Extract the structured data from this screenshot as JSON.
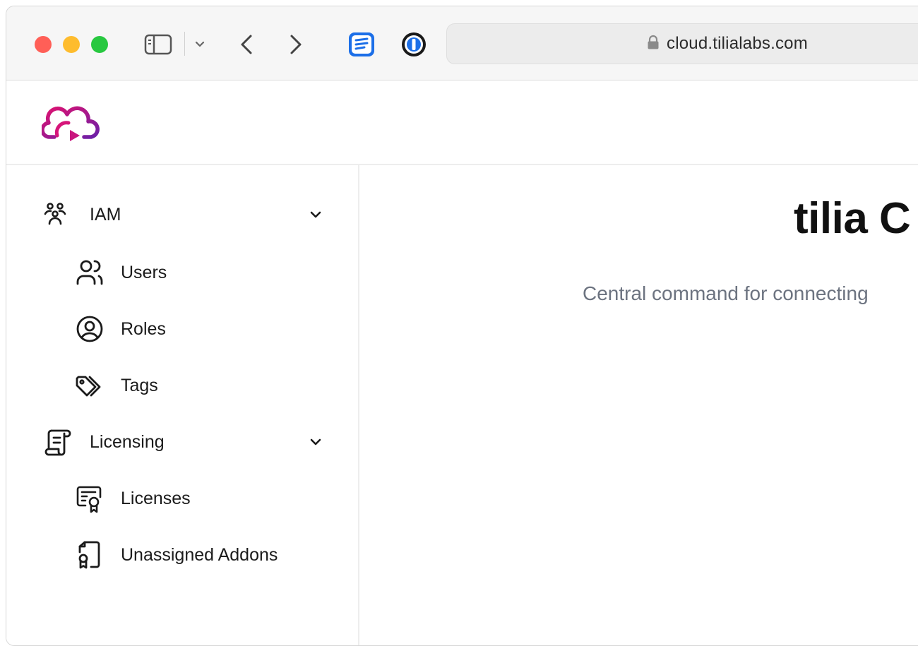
{
  "browser": {
    "url": "cloud.tilialabs.com",
    "traffic_lights": [
      "#ff5f57",
      "#febc2e",
      "#28c840"
    ]
  },
  "brand": {
    "logo_icon": "tilia-cloud-logo-icon",
    "colors": {
      "magenta": "#d6157a",
      "purple": "#6b1fa8"
    }
  },
  "sidebar": {
    "groups": [
      {
        "label": "IAM",
        "icon": "people-group-icon",
        "items": [
          {
            "label": "Users",
            "icon": "users-icon"
          },
          {
            "label": "Roles",
            "icon": "user-circle-icon"
          },
          {
            "label": "Tags",
            "icon": "tags-icon"
          }
        ]
      },
      {
        "label": "Licensing",
        "icon": "scroll-icon",
        "items": [
          {
            "label": "Licenses",
            "icon": "certificate-icon"
          },
          {
            "label": "Unassigned Addons",
            "icon": "document-badge-icon"
          }
        ]
      }
    ]
  },
  "main": {
    "title": "tilia C",
    "subtitle": "Central command for connecting"
  }
}
